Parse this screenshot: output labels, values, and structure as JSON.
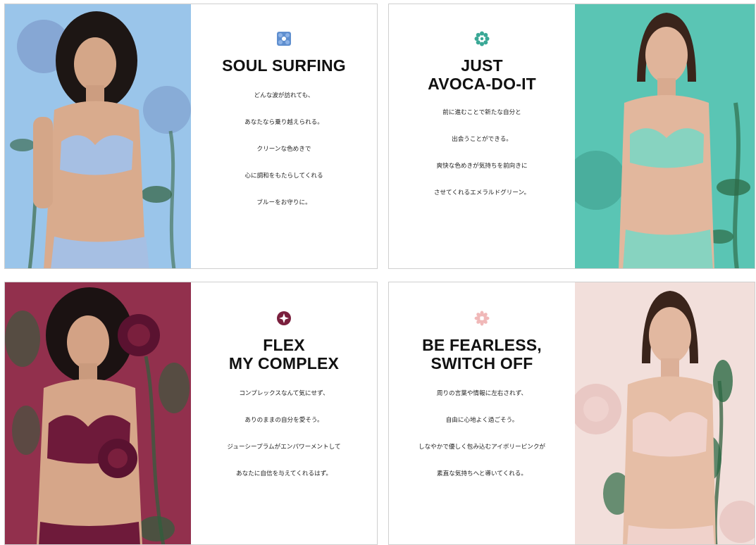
{
  "cards": [
    {
      "heading_lines": [
        "SOUL SURFING"
      ],
      "body_lines": [
        "どんな波が訪れても、",
        "あなたなら乗り越えられる。",
        "クリーンな色めきで",
        "心に調和をもたらしてくれる",
        "ブルーをお守りに。"
      ],
      "emblem_icon": "blue-flower-tile-icon",
      "accent": "#5f8fcf",
      "background": "#8fbde6",
      "garment": "#a6bfe3"
    },
    {
      "heading_lines": [
        "JUST",
        "AVOCA-DO-IT"
      ],
      "body_lines": [
        "前に進むことで新たな自分と",
        "出会うことができる。",
        "爽快な色めきが気持ちを前向きに",
        "させてくれるエメラルドグリーン。"
      ],
      "emblem_icon": "green-daisy-icon",
      "accent": "#3aa896",
      "background": "#4fbfae",
      "garment": "#87d3c0"
    },
    {
      "heading_lines": [
        "FLEX",
        "MY COMPLEX"
      ],
      "body_lines": [
        "コンプレックスなんて気にせず、",
        "ありのままの自分を愛そう。",
        "ジューシープラムがエンパワーメントして",
        "あなたに自信を与えてくれるはず。"
      ],
      "emblem_icon": "plum-star-badge-icon",
      "accent": "#7a1f3d",
      "background": "#8b2b47",
      "garment": "#6e1a3a"
    },
    {
      "heading_lines": [
        "BE FEARLESS,",
        "SWITCH OFF"
      ],
      "body_lines": [
        "周りの言葉や情報に左右されず、",
        "自由に心地よく過ごそう。",
        "しなやかで優しく包み込むアイボリーピンクが",
        "素直な気持ちへと導いてくれる。"
      ],
      "emblem_icon": "pink-flower-icon",
      "accent": "#f0b8b8",
      "background": "#efd9d6",
      "garment": "#f0d2cb"
    }
  ]
}
